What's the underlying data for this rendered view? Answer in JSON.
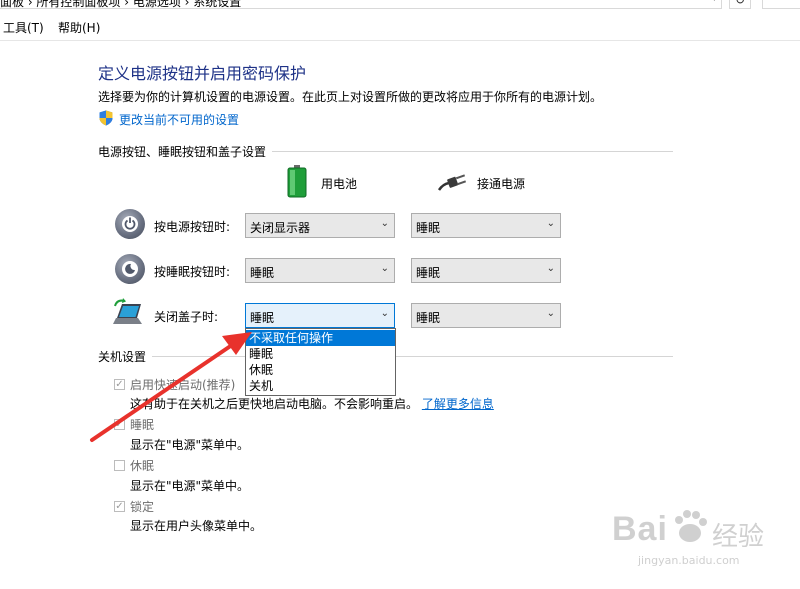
{
  "address_bar": {
    "breadcrumb": "面板 › 所有控制面板项 › 电源选项 › 系统设置"
  },
  "menu": {
    "tools": "工具(T)",
    "help": "帮助(H)"
  },
  "header": {
    "title": "定义电源按钮并启用密码保护",
    "description": "选择要为你的计算机设置的电源设置。在此页上对设置所做的更改将应用于你所有的电源计划。",
    "change_link": "更改当前不可用的设置"
  },
  "power_section": {
    "title": "电源按钮、睡眠按钮和盖子设置",
    "columns": {
      "battery": "用电池",
      "plugged": "接通电源"
    },
    "rows": [
      {
        "label": "按电源按钮时:",
        "battery_value": "关闭显示器",
        "plugged_value": "睡眠"
      },
      {
        "label": "按睡眠按钮时:",
        "battery_value": "睡眠",
        "plugged_value": "睡眠"
      },
      {
        "label": "关闭盖子时:",
        "battery_value": "睡眠",
        "plugged_value": "睡眠"
      }
    ],
    "open_dropdown": {
      "options": [
        "不采取任何操作",
        "睡眠",
        "休眠",
        "关机"
      ],
      "highlighted_index": 0
    }
  },
  "shutdown_section": {
    "title": "关机设置",
    "items": [
      {
        "label": "启用快速启动(推荐)",
        "checked": true,
        "description": "这有助于在关机之后更快地启动电脑。不会影响重启。",
        "link": "了解更多信息"
      },
      {
        "label": "睡眠",
        "checked": true,
        "description": "显示在\"电源\"菜单中。"
      },
      {
        "label": "休眠",
        "checked": false,
        "description": "显示在\"电源\"菜单中。"
      },
      {
        "label": "锁定",
        "checked": true,
        "description": "显示在用户头像菜单中。"
      }
    ]
  },
  "watermark": {
    "brand": "Bai",
    "brand_suffix": "经验",
    "url": "jingyan.baidu.com"
  },
  "colors": {
    "title": "#1e3287",
    "link": "#0066cc",
    "highlight": "#0078d7",
    "annotation_arrow": "#e8322c"
  }
}
